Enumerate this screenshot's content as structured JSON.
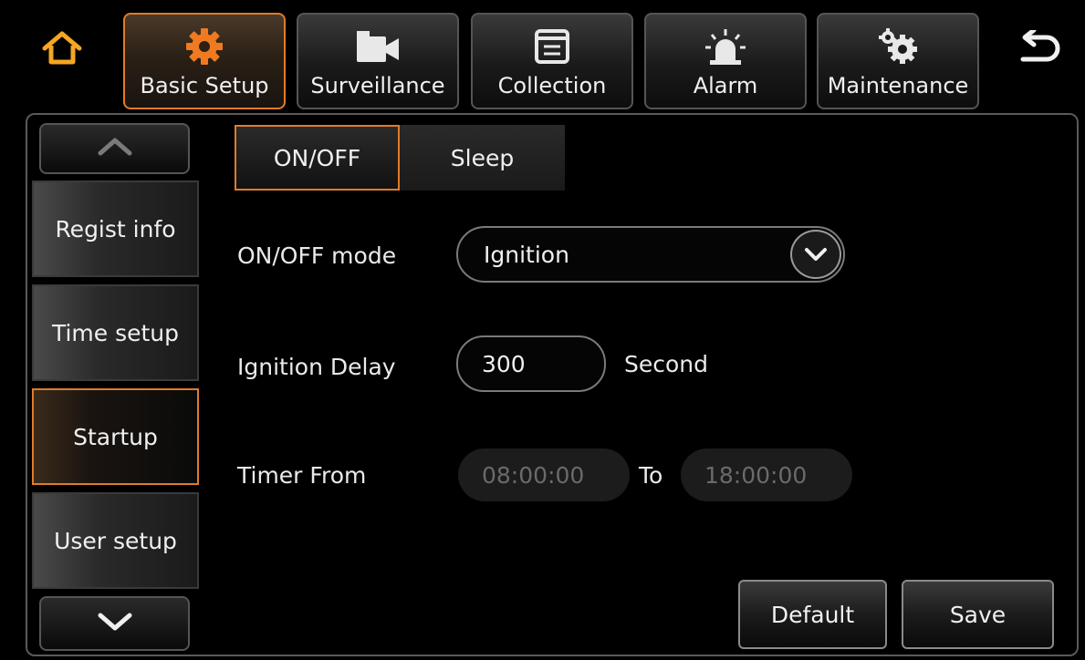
{
  "nav": {
    "home_icon": "home-icon",
    "back_icon": "back-icon",
    "tabs": [
      {
        "label": "Basic Setup",
        "icon": "gear-icon",
        "active": true
      },
      {
        "label": "Surveillance",
        "icon": "camera-icon",
        "active": false
      },
      {
        "label": "Collection",
        "icon": "document-icon",
        "active": false
      },
      {
        "label": "Alarm",
        "icon": "siren-icon",
        "active": false
      },
      {
        "label": "Maintenance",
        "icon": "gears-icon",
        "active": false
      }
    ]
  },
  "sidebar": {
    "up_icon": "chevron-up-icon",
    "down_icon": "chevron-down-icon",
    "items": [
      {
        "label": "Regist info"
      },
      {
        "label": "Time setup"
      },
      {
        "label": "Startup"
      },
      {
        "label": "User setup"
      }
    ],
    "active_index": 2
  },
  "subtabs": [
    {
      "label": "ON/OFF",
      "active": true
    },
    {
      "label": "Sleep",
      "active": false
    }
  ],
  "form": {
    "mode_label": "ON/OFF mode",
    "mode_value": "Ignition",
    "delay_label": "Ignition Delay",
    "delay_value": "300",
    "delay_unit": "Second",
    "timer_label": "Timer From",
    "timer_from": "08:00:00",
    "timer_to_label": "To",
    "timer_to": "18:00:00"
  },
  "actions": {
    "default_label": "Default",
    "save_label": "Save"
  },
  "colors": {
    "accent": "#e07b2a",
    "home": "#f5a623",
    "background": "#000000"
  }
}
